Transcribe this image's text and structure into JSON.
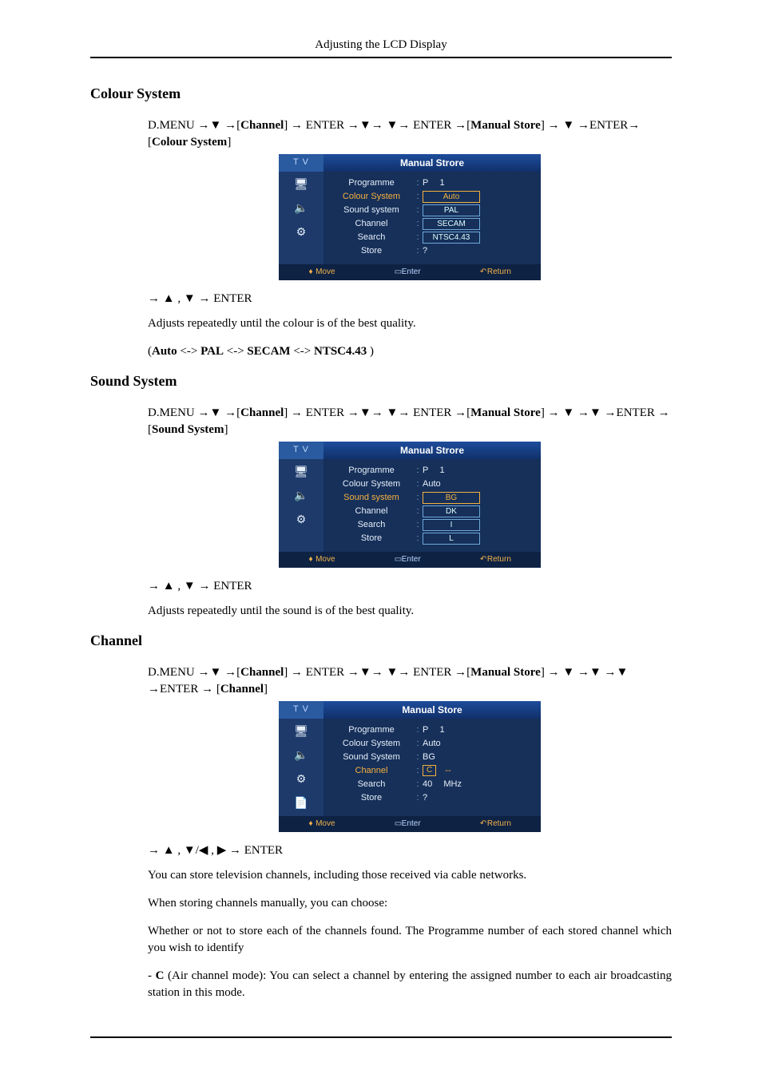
{
  "header": {
    "running_head": "Adjusting the LCD Display"
  },
  "section1": {
    "title": "Colour System",
    "seq_prefix": "D.MENU →",
    "seq_mid1": " →[",
    "channel_word": "Channel",
    "seq_mid2": "] → ENTER →",
    "seq_mid3": "→ ",
    "seq_mid4": "→ ENTER →[",
    "manual_store_word": "Manual Store",
    "seq_mid5": "] → ",
    "seq_mid6": " →ENTER→ [",
    "target_word": "Colour System",
    "seq_end": "]",
    "nav_line_prefix": "→ ",
    "nav_line_mid": " , ",
    "nav_line_suffix": " → ENTER",
    "desc": "Adjusts repeatedly until the colour is of the best quality.",
    "options_line_open": "(",
    "opt1": "Auto",
    "sep": " <-> ",
    "opt2": "PAL",
    "opt3": "SECAM",
    "opt4": "NTSC4.43",
    "options_line_close": " )"
  },
  "section2": {
    "title": "Sound System",
    "seq_prefix": "D.MENU →",
    "seq_mid1": " →[",
    "channel_word": "Channel",
    "seq_mid2": "] → ENTER →",
    "seq_mid3": "→ ",
    "seq_mid4": "→ ENTER →[",
    "manual_store_word": "Manual Store",
    "seq_mid5": "] → ",
    "seq_mid6": " →",
    "seq_mid7": " →ENTER → [",
    "target_word": "Sound System",
    "seq_end": "]",
    "nav_line_prefix": "→ ",
    "nav_line_mid": " , ",
    "nav_line_suffix": " → ENTER",
    "desc": "Adjusts repeatedly until the sound is of the best quality."
  },
  "section3": {
    "title": "Channel",
    "seq_prefix": "D.MENU →",
    "seq_mid1": " →[",
    "channel_word": "Channel",
    "seq_mid2": "] → ENTER →",
    "seq_mid3": "→ ",
    "seq_mid4": "→ ENTER →[",
    "manual_store_word": "Manual Store",
    "seq_mid5": "] → ",
    "seq_mid6": " →",
    "seq_mid7": " →",
    "seq_mid8": " →ENTER → [",
    "target_word": "Channel",
    "seq_end": "]",
    "nav_line_prefix": "→ ",
    "nav_line_mid1": " , ",
    "nav_line_mid2": "/",
    "nav_line_mid3": " , ",
    "nav_line_suffix": " → ENTER",
    "para1": "You can store television channels, including those received via cable networks.",
    "para2": "When storing channels manually, you can choose:",
    "para3": "Whether or not to store each of the channels found. The Programme number of each stored channel which you wish to identify",
    "para4_prefix": "- ",
    "para4_bold": "C",
    "para4_rest": " (Air channel mode): You can select a channel by entering the assigned number to each air broadcasting station in this mode."
  },
  "glyphs": {
    "down": "▼",
    "up": "▲",
    "left": "◀",
    "right": "▶"
  },
  "osd": {
    "tv_label": "T V",
    "title": "Manual Strore",
    "title3": "Manual Store",
    "labels": {
      "programme": "Programme",
      "colour_system": "Colour System",
      "sound_system_lc": "Sound system",
      "sound_system": "Sound System",
      "channel": "Channel",
      "search": "Search",
      "store": "Store"
    },
    "vals": {
      "P": "P",
      "one": "1",
      "auto": "Auto",
      "pal": "PAL",
      "secam": "SECAM",
      "ntsc": "NTSC4.43",
      "bg": "BG",
      "dk": "DK",
      "i": "I",
      "l": "L",
      "c": "C",
      "dashes": "--",
      "forty": "40",
      "mhz": "MHz",
      "qmark": "?"
    },
    "foot": {
      "move": "Move",
      "enter": "Enter",
      "return": "Return"
    },
    "icons": {
      "i1": "🖥",
      "i2": "🔈",
      "i3": "⚙",
      "i4": "📄"
    }
  }
}
